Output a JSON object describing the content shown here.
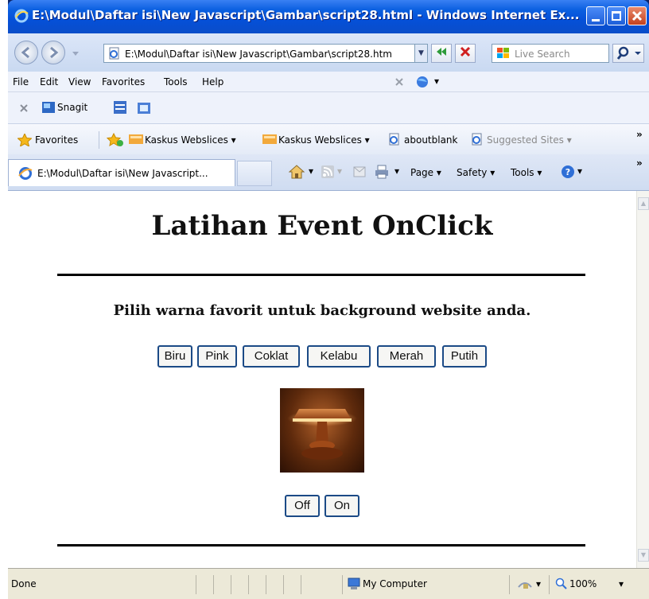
{
  "window": {
    "title": "E:\\Modul\\Daftar isi\\New Javascript\\Gambar\\script28.html - Windows Internet Ex..."
  },
  "address_bar": {
    "url": "E:\\Modul\\Daftar isi\\New Javascript\\Gambar\\script28.htm",
    "search_placeholder": "Live Search"
  },
  "menu": {
    "items": [
      "File",
      "Edit",
      "View",
      "Favorites",
      "Tools",
      "Help"
    ]
  },
  "toolbar": {
    "snagit_label": "Snagit"
  },
  "favorites_bar": {
    "favorites_label": "Favorites",
    "items": [
      "Kaskus Webslices ▾",
      "Kaskus Webslices ▾",
      "aboutblank",
      "Suggested Sites ▾"
    ]
  },
  "tab": {
    "label": "E:\\Modul\\Daftar isi\\New Javascript..."
  },
  "command_bar": {
    "page": "Page ▾",
    "safety": "Safety ▾",
    "tools": "Tools ▾"
  },
  "page": {
    "heading": "Latihan Event OnClick",
    "subtitle": "Pilih warna favorit untuk background website anda.",
    "color_buttons": [
      "Biru",
      "Pink",
      "Coklat",
      "Kelabu",
      "Merah",
      "Putih"
    ],
    "lamp_buttons": [
      "Off",
      "On"
    ]
  },
  "status_bar": {
    "status": "Done",
    "zone": "My Computer",
    "zoom": "100%"
  },
  "colors": {
    "titlebar": "#0550d8",
    "button_border": "#1b4a86",
    "status_bg": "#ece9d8"
  }
}
